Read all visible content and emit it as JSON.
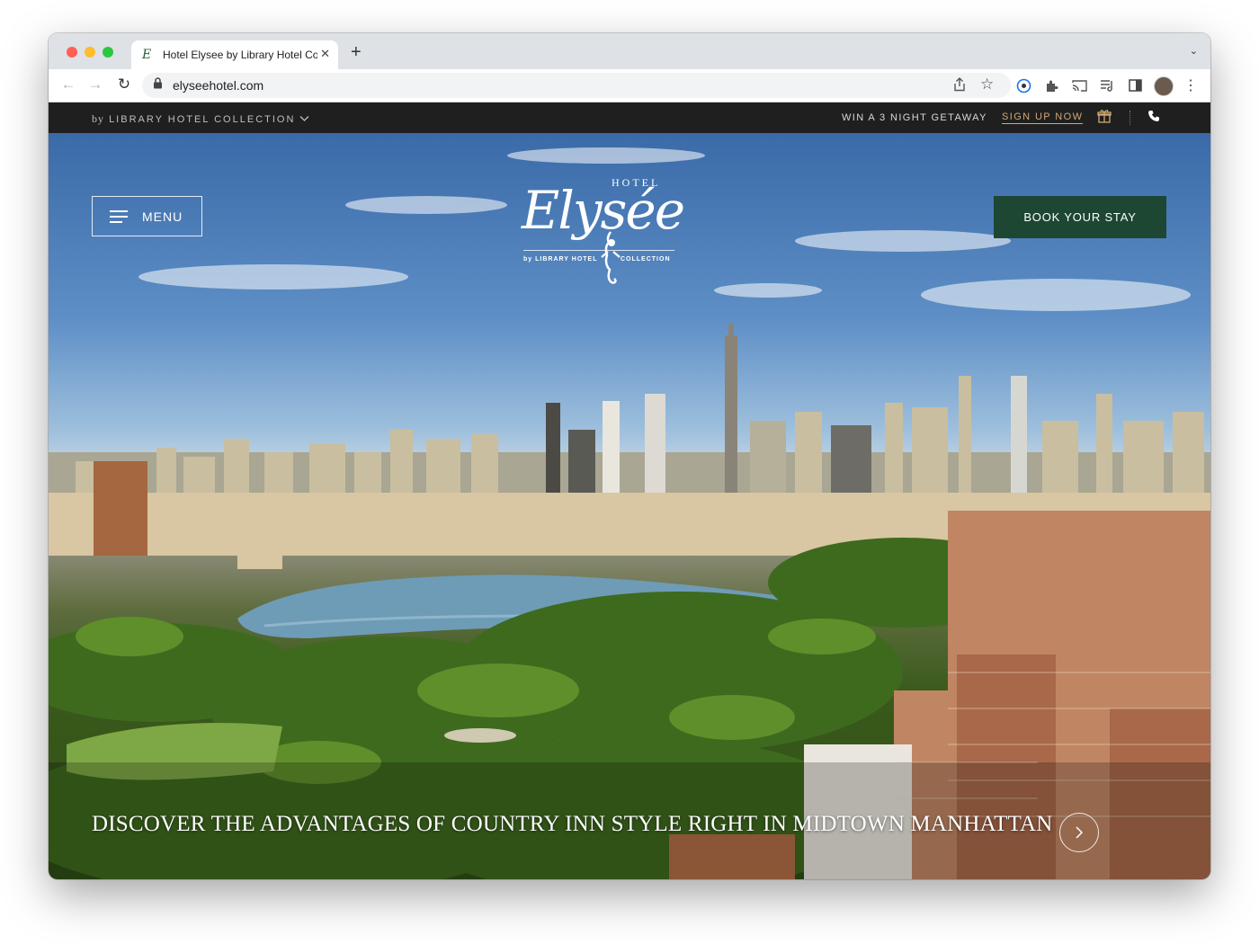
{
  "browser": {
    "tab_title": "Hotel Elysee by Library Hotel Collection",
    "favicon_letter": "E",
    "url": "elyseehotel.com",
    "icons": [
      "back-icon",
      "forward-icon",
      "reload-icon",
      "lock-icon",
      "share-icon",
      "star-icon",
      "extension-icon",
      "puzzle-icon",
      "cast-icon",
      "media-icon",
      "sidepanel-icon",
      "avatar",
      "more-icon"
    ]
  },
  "utility_bar": {
    "by_prefix": "by",
    "collection_label": "LIBRARY HOTEL COLLECTION",
    "getaway_text": "WIN A 3 NIGHT GETAWAY",
    "signup_text": "SIGN UP NOW"
  },
  "hero": {
    "menu_label": "MENU",
    "book_label": "BOOK YOUR STAY",
    "logo": {
      "hotel_word": "HOTEL",
      "script_name": "Elysée",
      "tag_left": "by LIBRARY HOTEL",
      "tag_right": "COLLECTION"
    },
    "headline": "DISCOVER THE ADVANTAGES OF COUNTRY INN STYLE RIGHT IN MIDTOWN MANHATTAN"
  },
  "colors": {
    "brand_green": "#1d4733",
    "accent_gold": "#d2a874",
    "utility_bg": "#1f1f1f"
  }
}
